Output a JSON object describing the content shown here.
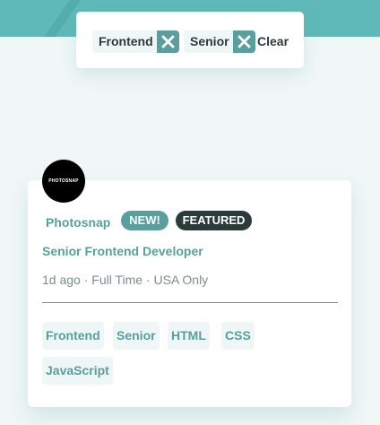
{
  "filters": {
    "chips": [
      {
        "label": "Frontend",
        "remove_icon": "close-icon"
      },
      {
        "label": "Senior",
        "remove_icon": "close-icon"
      }
    ],
    "clear_label": "Clear"
  },
  "job": {
    "logo_text": "PHOTOSNAP",
    "company": "Photosnap",
    "badge_new": "NEW!",
    "badge_featured": "FEATURED",
    "position": "Senior Frontend Developer",
    "meta": "1d ago · Full Time · USA Only",
    "tags": [
      "Frontend",
      "Senior",
      "HTML",
      "CSS",
      "JavaScript"
    ]
  },
  "colors": {
    "header": "#5fb9b9",
    "accent": "#5a9e9e",
    "dark": "#2d3a3a",
    "page_bg": "#f0f7f6",
    "tag_bg": "#eef6f6",
    "meta_text": "#7b8e8e"
  }
}
